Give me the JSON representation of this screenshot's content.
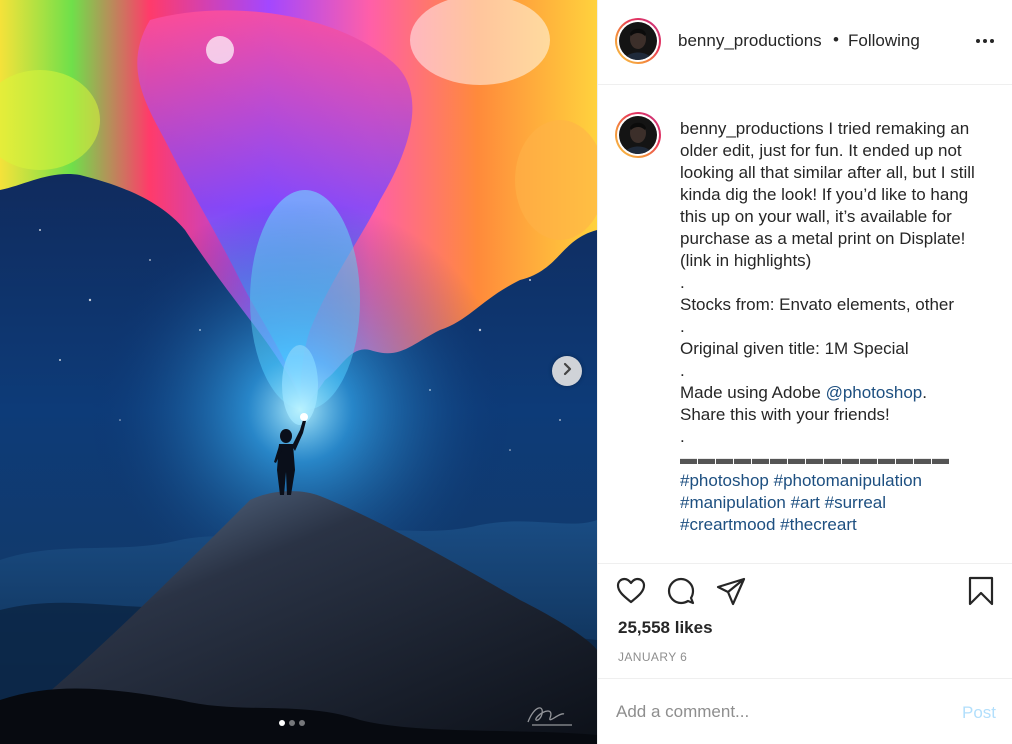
{
  "post": {
    "username": "benny_productions",
    "separator": "•",
    "follow_status": "Following",
    "caption": {
      "username": "benny_productions",
      "lines": [
        " I tried remaking an older edit, just for fun. It ended up not looking all that similar after all, but I still kinda dig the look! If you’d like to hang this up on your wall, it’s available for purchase as a metal print on Displate! (link in highlights)",
        ".",
        "Stocks from: Envato elements, other",
        ".",
        "Original given title: 1M Special",
        "."
      ],
      "made_using_prefix": "Made using Adobe ",
      "made_using_mention": "@photoshop",
      "made_using_suffix": ".",
      "share_line": "Share this with your friends!",
      "dot_line": ".",
      "divider_line": "▬▬▬▬▬▬▬▬▬▬▬▬▬▬▬",
      "hashtags": [
        "#photoshop",
        "#photomanipulation",
        "#manipulation",
        "#art",
        "#surreal",
        "#creartmood",
        "#thecreart"
      ]
    },
    "likes": "25,558 likes",
    "date": "JANUARY 6",
    "comment_placeholder": "Add a comment...",
    "post_label": "Post",
    "carousel": {
      "slides": 3,
      "active_index": 0
    }
  },
  "icons": {
    "more": "more-options-icon",
    "like": "heart-icon",
    "comment": "comment-icon",
    "share": "share-icon",
    "save": "bookmark-icon",
    "next": "chevron-right-icon"
  },
  "colors": {
    "link": "#1d4f80",
    "post_button_disabled": "#b2dffc",
    "muted": "#8e8e8e",
    "text": "#262626"
  }
}
